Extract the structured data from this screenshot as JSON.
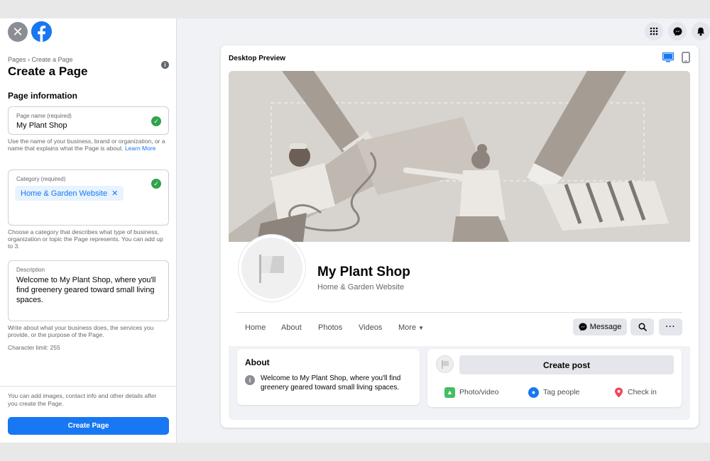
{
  "sidebar": {
    "breadcrumb": "Pages › Create a Page",
    "title": "Create a Page",
    "section_title": "Page information",
    "page_name": {
      "label": "Page name (required)",
      "value": "My Plant Shop",
      "help": "Use the name of your business, brand or organization, or a name that explains what the Page is about.",
      "help_link": "Learn More"
    },
    "category": {
      "label": "Category (required)",
      "chip": "Home & Garden Website",
      "help": "Choose a category that describes what type of business, organization or topic the Page represents. You can add up to 3."
    },
    "description": {
      "label": "Description",
      "value": "Welcome to My Plant Shop, where you'll find greenery geared toward small living spaces.",
      "help": "Write about what your business does, the services you provide, or the purpose of the Page.",
      "char_limit": "Character limit: 255"
    },
    "footer_note": "You can add images, contact info and other details after you create the Page.",
    "create_button": "Create Page"
  },
  "preview": {
    "title": "Desktop Preview",
    "page_name": "My Plant Shop",
    "page_category": "Home & Garden Website",
    "tabs": [
      "Home",
      "About",
      "Photos",
      "Videos",
      "More"
    ],
    "message_button": "Message",
    "about": {
      "title": "About",
      "text": "Welcome to My Plant Shop, where you'll find greenery geared toward small living spaces."
    },
    "create_post": "Create post",
    "actions": {
      "photo_video": "Photo/video",
      "tag_people": "Tag people",
      "check_in": "Check in"
    }
  },
  "colors": {
    "brand": "#1877f2",
    "success": "#31a24c",
    "background": "#f0f2f5",
    "cover": "#d5d1cc"
  },
  "icons": [
    "close-icon",
    "facebook-logo",
    "info-icon",
    "check-icon",
    "menu-grid-icon",
    "messenger-icon",
    "notifications-icon",
    "desktop-icon",
    "mobile-icon",
    "flag-icon",
    "search-icon",
    "more-icon",
    "photo-icon",
    "tag-people-icon",
    "location-pin-icon"
  ]
}
